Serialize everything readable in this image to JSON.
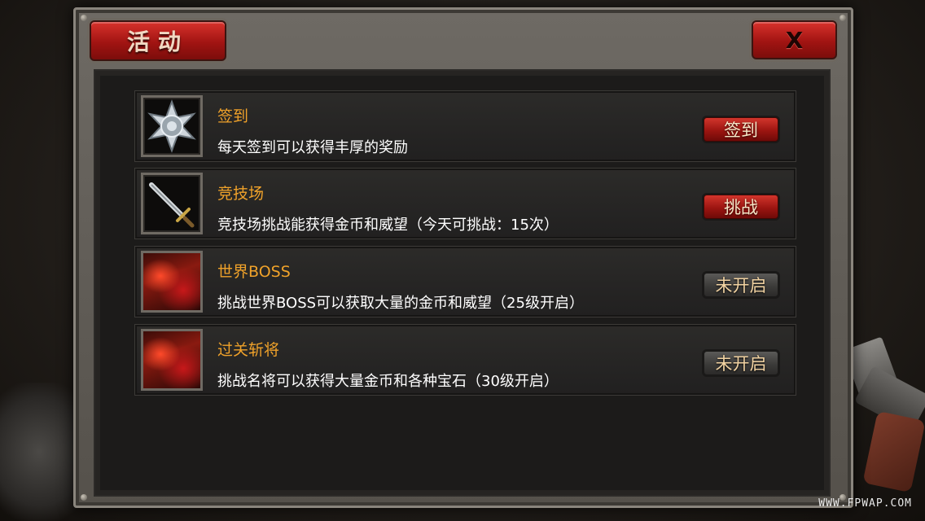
{
  "window": {
    "title": "活动",
    "close_label": "X"
  },
  "activities": [
    {
      "name": "签到",
      "description": "每天签到可以获得丰厚的奖励",
      "action_label": "签到",
      "action_state": "active",
      "icon": "star-medal-icon"
    },
    {
      "name": "竞技场",
      "description": "竞技场挑战能获得金币和威望（今天可挑战：15次）",
      "action_label": "挑战",
      "action_state": "active",
      "icon": "sword-icon"
    },
    {
      "name": "世界BOSS",
      "description": "挑战世界BOSS可以获取大量的金币和威望（25级开启）",
      "action_label": "未开启",
      "action_state": "locked",
      "icon": "boss-tank-icon"
    },
    {
      "name": "过关斩将",
      "description": "挑战名将可以获得大量金币和各种宝石（30级开启）",
      "action_label": "未开启",
      "action_state": "locked",
      "icon": "boss-tank-icon"
    }
  ],
  "watermark": "WWW.FPWAP.COM",
  "colors": {
    "accent_red": "#b01a16",
    "name_orange": "#f0a22a",
    "locked_gray": "#3c3b39"
  }
}
